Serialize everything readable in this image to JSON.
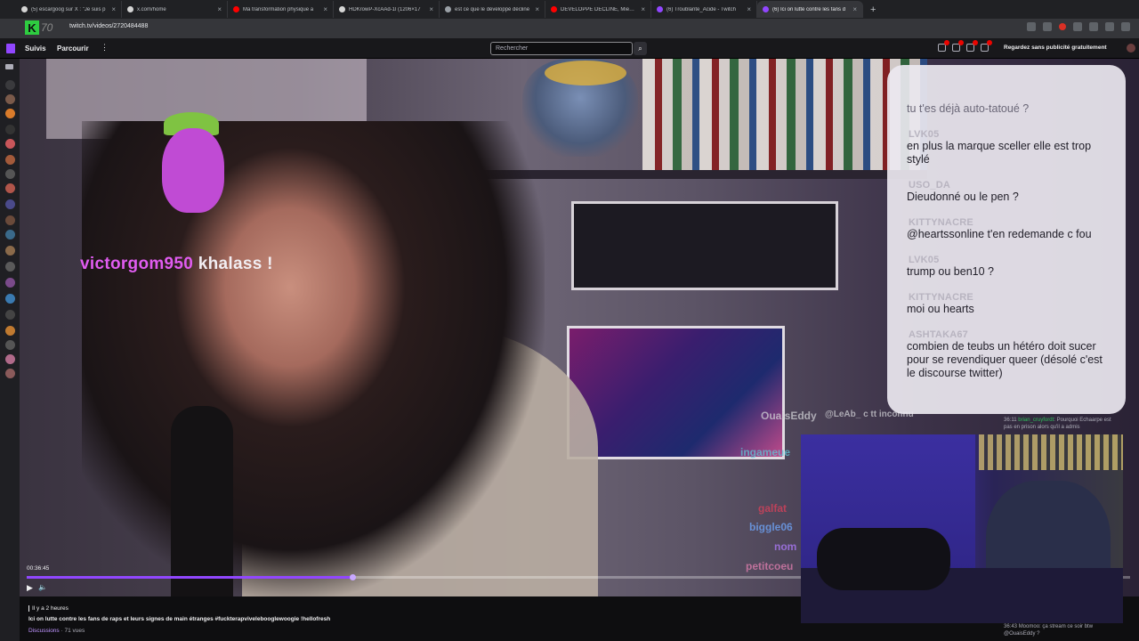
{
  "browser": {
    "tabs": [
      {
        "title": "(5) escargoog sur X : \"Je suis p",
        "favicon_color": "#d5d5d5"
      },
      {
        "title": "x.com/home",
        "favicon_color": "#d5d5d5"
      },
      {
        "title": "Ma transformation physique a",
        "favicon_color": "#ff0000"
      },
      {
        "title": "HDKrowP-XcAAd-1l (1206×17",
        "favicon_color": "#d5d5d5"
      },
      {
        "title": "est ce que le développé décliné",
        "favicon_color": "#9aa0a6"
      },
      {
        "title": "DÉVELOPPÉ DÉCLINÉ, Mieux qu",
        "favicon_color": "#ff0000"
      },
      {
        "title": "(6) Troublante_Acide - Twitch",
        "favicon_color": "#9146ff"
      },
      {
        "title": "(6) Ici on lutte contre les fans d",
        "favicon_color": "#9146ff"
      }
    ],
    "active_tab": 7,
    "new_tab": "+",
    "close_glyph": "×",
    "url": "twitch.tv/videos/2720484488",
    "logo_text": "70"
  },
  "twitch_nav": {
    "following": "Suivis",
    "browse": "Parcourir",
    "more": "⋮",
    "search_placeholder": "Rechercher",
    "search_icon": "⌕",
    "ad_free": "Regardez sans publicité gratuitement",
    "notification_badges": [
      "1",
      "1",
      "8",
      "1"
    ]
  },
  "stream_overlay": {
    "alert_user": "victorgom950",
    "alert_message": "khalass !",
    "chat": [
      {
        "user": "",
        "text": "tu t'es déjà auto-tatoué ?"
      },
      {
        "user": "LVK05",
        "text": "en plus la marque sceller elle est trop stylé"
      },
      {
        "user": "USO_DA",
        "text": "Dieudonné ou le pen ?"
      },
      {
        "user": "KITTYNACRE",
        "text": "@heartssonline t'en redemande c fou"
      },
      {
        "user": "LVK05",
        "text": "trump ou ben10 ?"
      },
      {
        "user": "KITTYNACRE",
        "text": "moi ou hearts"
      },
      {
        "user": "ASHTAKA67",
        "text": "combien de teubs un hétéro doit sucer pour se revendiquer queer (désolé c'est le discourse twitter)"
      }
    ],
    "floating_names": [
      {
        "text": "OuaisEddy",
        "color": "#cfcfd4"
      },
      {
        "text": "@LeAb_ c tt inconnu",
        "color": "#cfcfd4"
      },
      {
        "text": "ingameue",
        "color": "#5fc8d8"
      },
      {
        "text": "galfat",
        "color": "#e0405a"
      },
      {
        "text": "biggle06",
        "color": "#6fa8ff"
      },
      {
        "text": "nom",
        "color": "#b07cff"
      },
      {
        "text": "petitcoeu",
        "color": "#e27fb0"
      }
    ]
  },
  "player": {
    "timestamp": "00:36:45",
    "progress": 0.295,
    "play_icon": "▶",
    "volume_icon": "🔈"
  },
  "side_chat": [
    {
      "time": "36:11",
      "user": "brian_cruyfordt",
      "text": "Pourquoi Echaarpe est pas en prison alors qu'il a admis"
    },
    {
      "time": "36:43",
      "user": "Moomoo",
      "text": "ça stream ce soir btw @OuaisEddy ?"
    }
  ],
  "video_info": {
    "ago": "Il y a 2 heures",
    "title": "Ici on lutte contre les fans de raps et leurs signes de main étranges #fuckterapvivelebooglewoogie !hellofresh",
    "category": "Discussions",
    "views": "· 71 vues"
  },
  "colors": {
    "twitch_purple": "#9147ff",
    "overlay_card": "#ece8f0",
    "alert_user": "#e05cf0"
  }
}
